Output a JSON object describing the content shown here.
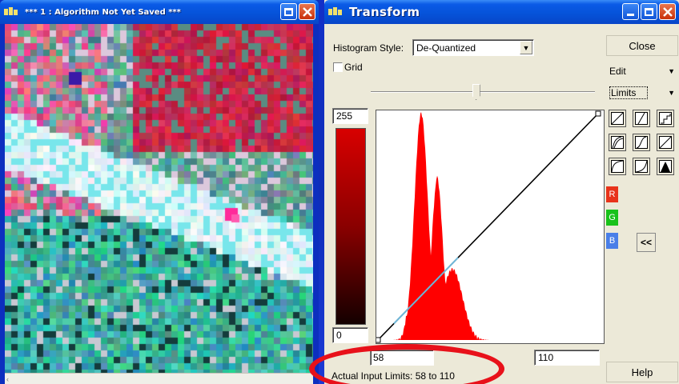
{
  "image_window": {
    "title": "*** 1 : Algorithm Not Yet Saved ***",
    "scroll_arrow": "‹"
  },
  "transform_window": {
    "title": "Transform",
    "histogram_style": {
      "label": "Histogram Style:",
      "value": "De-Quantized"
    },
    "grid": {
      "label": "Grid",
      "checked": false
    },
    "slider_position": 0.47,
    "scale": {
      "max": "255",
      "min": "0"
    },
    "input_limits": {
      "low": "58",
      "high": "110"
    },
    "status": "Actual Input Limits: 58 to 110",
    "buttons": {
      "close": "Close",
      "help": "Help",
      "collapse": "<<"
    },
    "menus": {
      "edit": "Edit",
      "limits": "Limits"
    },
    "channels": [
      {
        "label": "R",
        "color": "#e8331a"
      },
      {
        "label": "G",
        "color": "#19c21b"
      },
      {
        "label": "B",
        "color": "#4a7fe8"
      }
    ],
    "colors": {
      "histogram": "#ff0000",
      "transfer_line": "#000000",
      "transfer_line_overlap": "#6fb7d8"
    }
  }
}
